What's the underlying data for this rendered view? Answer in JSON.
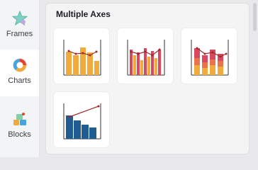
{
  "sidebar": {
    "items": [
      {
        "label": "Frames",
        "icon": "frames-icon",
        "active": false
      },
      {
        "label": "Charts",
        "icon": "charts-icon",
        "active": true
      },
      {
        "label": "Blocks",
        "icon": "blocks-icon",
        "active": false
      }
    ]
  },
  "panel": {
    "title": "Multiple Axes",
    "cards": [
      {
        "name": "bar-line-yellow",
        "style": "single-bar-with-line"
      },
      {
        "name": "grouped-bar-line",
        "style": "grouped-bar-with-line"
      },
      {
        "name": "stacked-bar-line",
        "style": "stacked-bar-with-line"
      },
      {
        "name": "bar-line-blue",
        "style": "single-bar-with-line-blue"
      }
    ]
  },
  "colors": {
    "accent_active": "#e5452f",
    "bar_yellow": "#f0ab3c",
    "bar_red": "#d9485f",
    "bar_blue": "#1f5c91",
    "line_dark_red": "#9e2a2b"
  }
}
